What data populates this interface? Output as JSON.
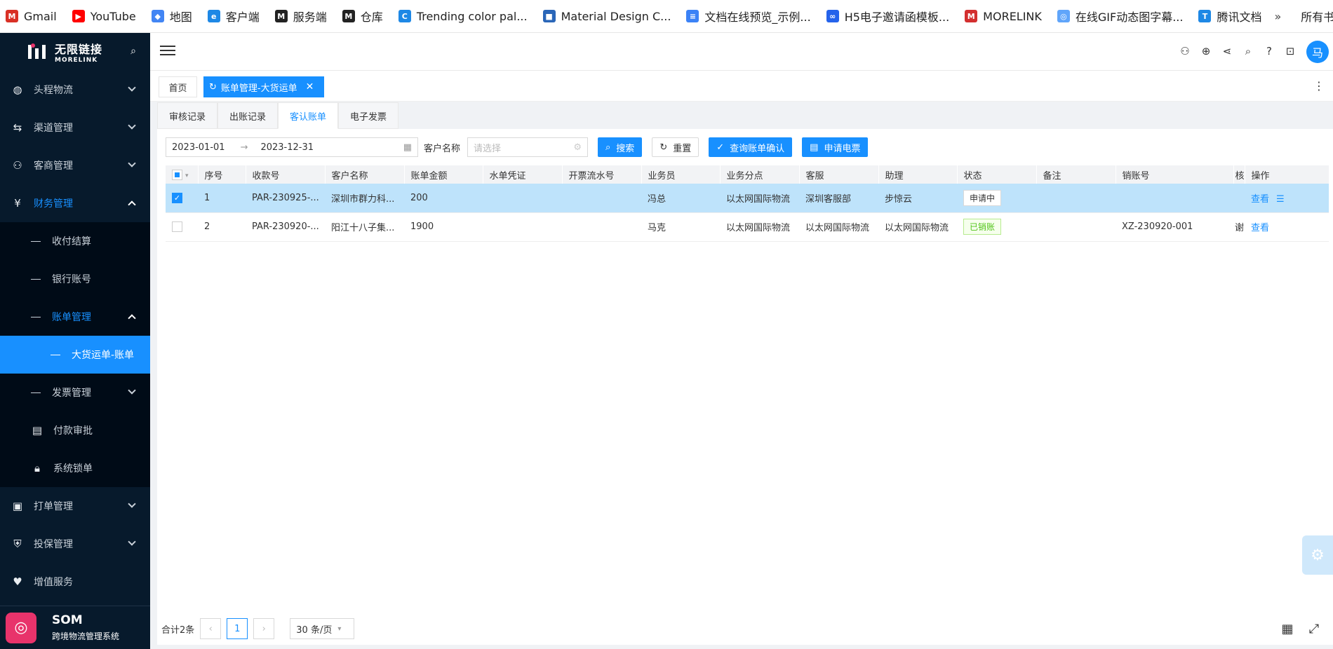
{
  "bookmarks": [
    {
      "label": "Gmail",
      "icon": "gmail-icon",
      "color": "#d93025",
      "glyph": "M"
    },
    {
      "label": "YouTube",
      "icon": "youtube-icon",
      "color": "#ff0000",
      "glyph": "▶"
    },
    {
      "label": "地图",
      "icon": "map-icon",
      "color": "#4285f4",
      "glyph": "◆"
    },
    {
      "label": "客户端",
      "icon": "client-icon",
      "color": "#1e88e5",
      "glyph": "e"
    },
    {
      "label": "服务端",
      "icon": "server-icon",
      "color": "#222222",
      "glyph": "M"
    },
    {
      "label": "仓库",
      "icon": "warehouse-icon",
      "color": "#222222",
      "glyph": "M"
    },
    {
      "label": "Trending color pal...",
      "icon": "coolors-icon",
      "color": "#1e88e5",
      "glyph": "C"
    },
    {
      "label": "Material Design C...",
      "icon": "material-icon",
      "color": "#2a66b8",
      "glyph": "■"
    },
    {
      "label": "文档在线预览_示例...",
      "icon": "doc-icon",
      "color": "#3b82f6",
      "glyph": "≡"
    },
    {
      "label": "H5电子邀请函模板...",
      "icon": "h5-icon",
      "color": "#2563eb",
      "glyph": "∞"
    },
    {
      "label": "MORELINK",
      "icon": "morelink-icon",
      "color": "#d32f2f",
      "glyph": "M"
    },
    {
      "label": "在线GIF动态图字幕...",
      "icon": "gif-icon",
      "color": "#60a5fa",
      "glyph": "◎"
    },
    {
      "label": "腾讯文档",
      "icon": "tencent-doc-icon",
      "color": "#1e88e5",
      "glyph": "T"
    }
  ],
  "bookmarks_more": "»",
  "bookmarks_folder": "所有书签",
  "brand": {
    "name_cn": "无限链接",
    "name_en": "MORELINK"
  },
  "sidebar": {
    "items": [
      {
        "label": "头程物流",
        "icon": "globe-icon",
        "glyph": "◍"
      },
      {
        "label": "渠道管理",
        "icon": "route-icon",
        "glyph": "⇆"
      },
      {
        "label": "客商管理",
        "icon": "users-icon",
        "glyph": "⚇"
      },
      {
        "label": "财务管理",
        "icon": "yen-icon",
        "glyph": "¥"
      }
    ],
    "finance_sub": [
      {
        "label": "收付结算"
      },
      {
        "label": "银行账号"
      },
      {
        "label": "账单管理"
      }
    ],
    "bill_sub": [
      {
        "label": "大货运单-账单"
      }
    ],
    "finance_sub2": [
      {
        "label": "发票管理"
      },
      {
        "label": "付款审批"
      },
      {
        "label": "系统锁单"
      }
    ],
    "items2": [
      {
        "label": "打单管理",
        "glyph": "▣"
      },
      {
        "label": "投保管理",
        "glyph": "⛨"
      },
      {
        "label": "增值服务",
        "glyph": "♥"
      }
    ],
    "footer": {
      "title": "SOM",
      "subtitle": "跨境物流管理系统"
    }
  },
  "header": {
    "avatar": "马"
  },
  "tabs": {
    "home": "首页",
    "active": "账单管理-大货运单"
  },
  "subtabs": [
    "审核记录",
    "出账记录",
    "客认账单",
    "电子发票"
  ],
  "filters": {
    "date_start": "2023-01-01",
    "date_sep": "→",
    "date_end": "2023-12-31",
    "customer_label": "客户名称",
    "customer_placeholder": "请选择",
    "search_btn": "搜索",
    "reset_btn": "重置",
    "confirm_btn": "查询账单确认",
    "invoice_btn": "申请电票"
  },
  "table": {
    "headers": [
      "序号",
      "收款号",
      "客户名称",
      "账单金额",
      "水单凭证",
      "开票流水号",
      "业务员",
      "业务分点",
      "客服",
      "助理",
      "状态",
      "备注",
      "销账号",
      "核",
      "操作"
    ],
    "rows": [
      {
        "no": "1",
        "pay_no": "PAR-230925-...",
        "customer": "深圳市群力科...",
        "amount": "200",
        "receipt": "",
        "serial": "",
        "sales": "冯总",
        "branch": "以太网国际物流",
        "service": "深圳客服部",
        "assistant": "步惊云",
        "status": "申请中",
        "remark": "",
        "writeoff": "",
        "check": "",
        "action": "查看"
      },
      {
        "no": "2",
        "pay_no": "PAR-230920-...",
        "customer": "阳江十八子集...",
        "amount": "1900",
        "receipt": "",
        "serial": "",
        "sales": "马克",
        "branch": "以太网国际物流",
        "service": "以太网国际物流",
        "assistant": "以太网国际物流",
        "status": "已销账",
        "remark": "",
        "writeoff": "XZ-230920-001",
        "check": "谢",
        "action": "查看"
      }
    ]
  },
  "pager": {
    "total": "合计2条",
    "page": "1",
    "size": "30 条/页"
  },
  "colors": {
    "primary": "#1890ff",
    "sidebar_bg": "#071a2c",
    "selected_row": "#bee3fb"
  }
}
